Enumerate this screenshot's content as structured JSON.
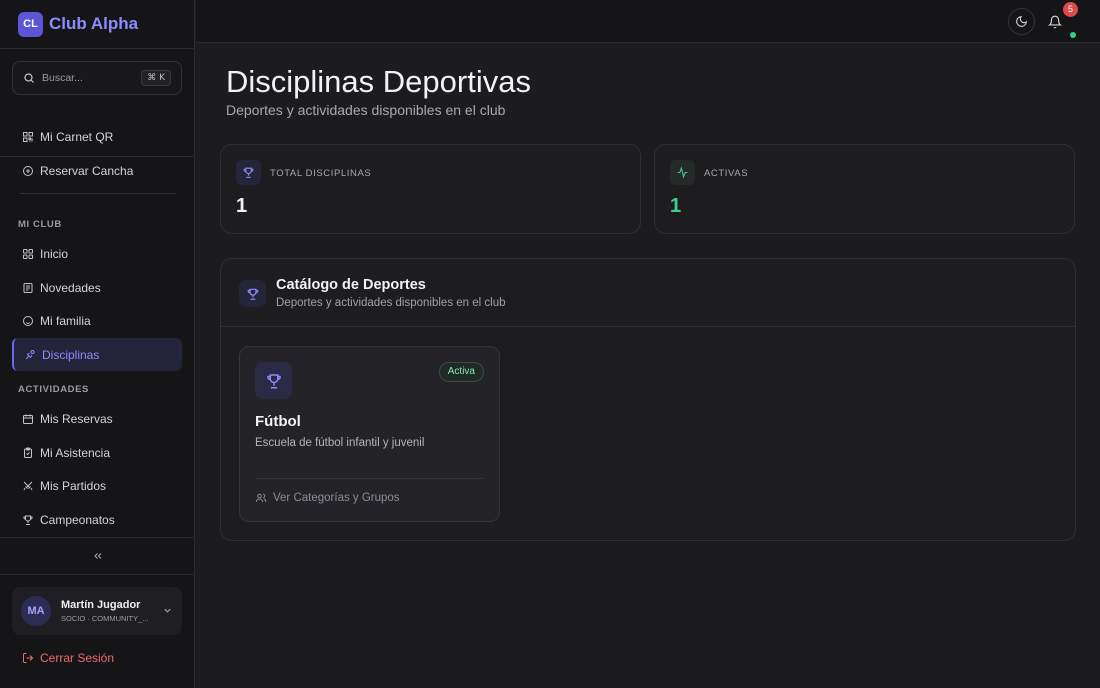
{
  "brand": {
    "logo": "CL",
    "name": "Club Alpha"
  },
  "search": {
    "placeholder": "Buscar...",
    "shortcut": "⌘ K"
  },
  "quick_links": [
    {
      "label": "Mi Carnet QR",
      "icon": "qr-code-icon"
    },
    {
      "label": "Reservar Cancha",
      "icon": "plus-circle-icon"
    }
  ],
  "sections": {
    "mi_club": {
      "title": "MI CLUB",
      "items": [
        {
          "label": "Inicio",
          "icon": "grid-icon"
        },
        {
          "label": "Novedades",
          "icon": "newspaper-icon"
        },
        {
          "label": "Mi familia",
          "icon": "family-icon"
        },
        {
          "label": "Disciplinas",
          "icon": "disciplines-icon",
          "active": true
        }
      ]
    },
    "actividades": {
      "title": "ACTIVIDADES",
      "items": [
        {
          "label": "Mis Reservas",
          "icon": "calendar-icon"
        },
        {
          "label": "Mi Asistencia",
          "icon": "clipboard-check-icon"
        },
        {
          "label": "Mis Partidos",
          "icon": "swords-icon"
        },
        {
          "label": "Campeonatos",
          "icon": "trophy-icon"
        }
      ]
    }
  },
  "user": {
    "initials": "MA",
    "name": "Martín Jugador",
    "role": "SOCIO · COMMUNITY_..."
  },
  "logout_label": "Cerrar Sesión",
  "topbar": {
    "notifications_count": "5"
  },
  "page": {
    "title": "Disciplinas Deportivas",
    "subtitle": "Deportes y actividades disponibles en el club"
  },
  "stats": [
    {
      "label": "TOTAL DISCIPLINAS",
      "value": "1",
      "icon": "trophy-icon",
      "color": "#8e8bff"
    },
    {
      "label": "ACTIVAS",
      "value": "1",
      "icon": "activity-icon",
      "color": "#3ecf8e"
    }
  ],
  "catalog": {
    "title": "Catálogo de Deportes",
    "subtitle": "Deportes y actividades disponibles en el club",
    "sports": [
      {
        "name": "Fútbol",
        "description": "Escuela de fútbol infantil y juvenil",
        "status": "Activa",
        "link": "Ver Categorías y Grupos"
      }
    ]
  },
  "colors": {
    "accent": "#8e8bff",
    "success": "#3ecf8e",
    "danger": "#f06a6a",
    "background": "#1c1c1f"
  }
}
